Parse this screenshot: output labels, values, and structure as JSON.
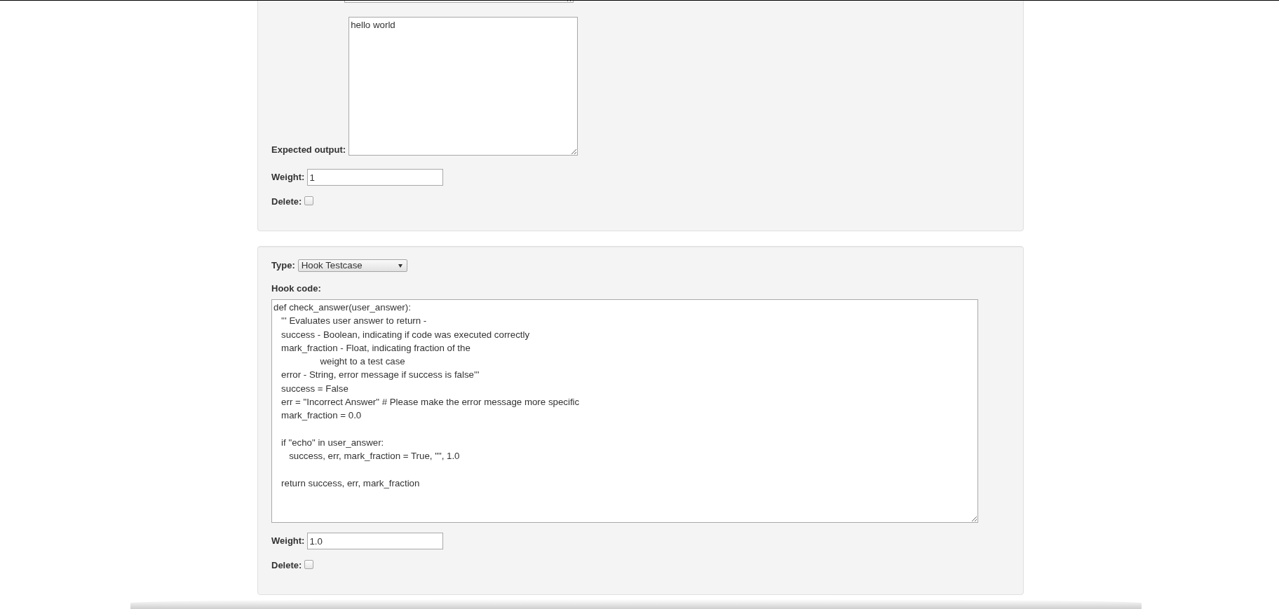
{
  "panels": [
    {
      "fields": [
        {
          "kind": "textarea"
        },
        {
          "kind": "textarea",
          "label": "Expected output:",
          "value": "hello world"
        },
        {
          "kind": "text",
          "label": "Weight:",
          "value": "1"
        },
        {
          "kind": "checkbox",
          "label": "Delete:",
          "checked": false
        }
      ]
    },
    {
      "fields": [
        {
          "kind": "select",
          "label": "Type:",
          "value": "Hook Testcase"
        },
        {
          "kind": "code",
          "label": "Hook code:",
          "value": "def check_answer(user_answer):\n   ''' Evaluates user answer to return -\n   success - Boolean, indicating if code was executed correctly\n   mark_fraction - Float, indicating fraction of the\n                  weight to a test case\n   error - String, error message if success is false'''\n   success = False\n   err = \"Incorrect Answer\" # Please make the error message more specific\n   mark_fraction = 0.0\n\n   if \"echo\" in user_answer:\n      success, err, mark_fraction = True, \"\", 1.0\n\n   return success, err, mark_fraction"
        },
        {
          "kind": "text",
          "label": "Weight:",
          "value": "1.0"
        },
        {
          "kind": "checkbox",
          "label": "Delete:",
          "checked": false
        }
      ]
    }
  ]
}
